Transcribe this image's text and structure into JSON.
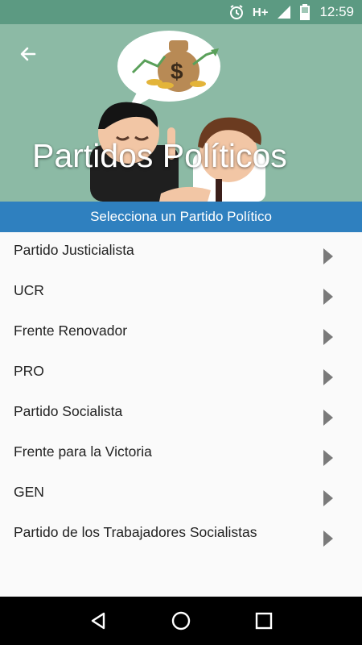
{
  "status_bar": {
    "network_type": "H+",
    "time": "12:59",
    "icons": [
      "alarm-icon",
      "signal-icon",
      "battery-icon"
    ]
  },
  "header": {
    "title": "Partidos Políticos",
    "back_icon": "arrow-left-icon"
  },
  "subheader": {
    "text": "Selecciona un Partido Político"
  },
  "parties": [
    {
      "label": "Partido Justicialista"
    },
    {
      "label": "UCR"
    },
    {
      "label": "Frente Renovador"
    },
    {
      "label": "PRO"
    },
    {
      "label": "Partido Socialista"
    },
    {
      "label": "Frente para la Victoria"
    },
    {
      "label": "GEN"
    },
    {
      "label": "Partido de los Trabajadores Socialistas"
    }
  ],
  "navigation": {
    "buttons": [
      "back-triangle-icon",
      "home-circle-icon",
      "recents-square-icon"
    ]
  },
  "colors": {
    "status_bar": "#5c9a82",
    "header_bg": "#8cbaa5",
    "subheader_bg": "#2f80bf",
    "list_bg": "#fafafa",
    "arrow": "#7a7a7a"
  }
}
